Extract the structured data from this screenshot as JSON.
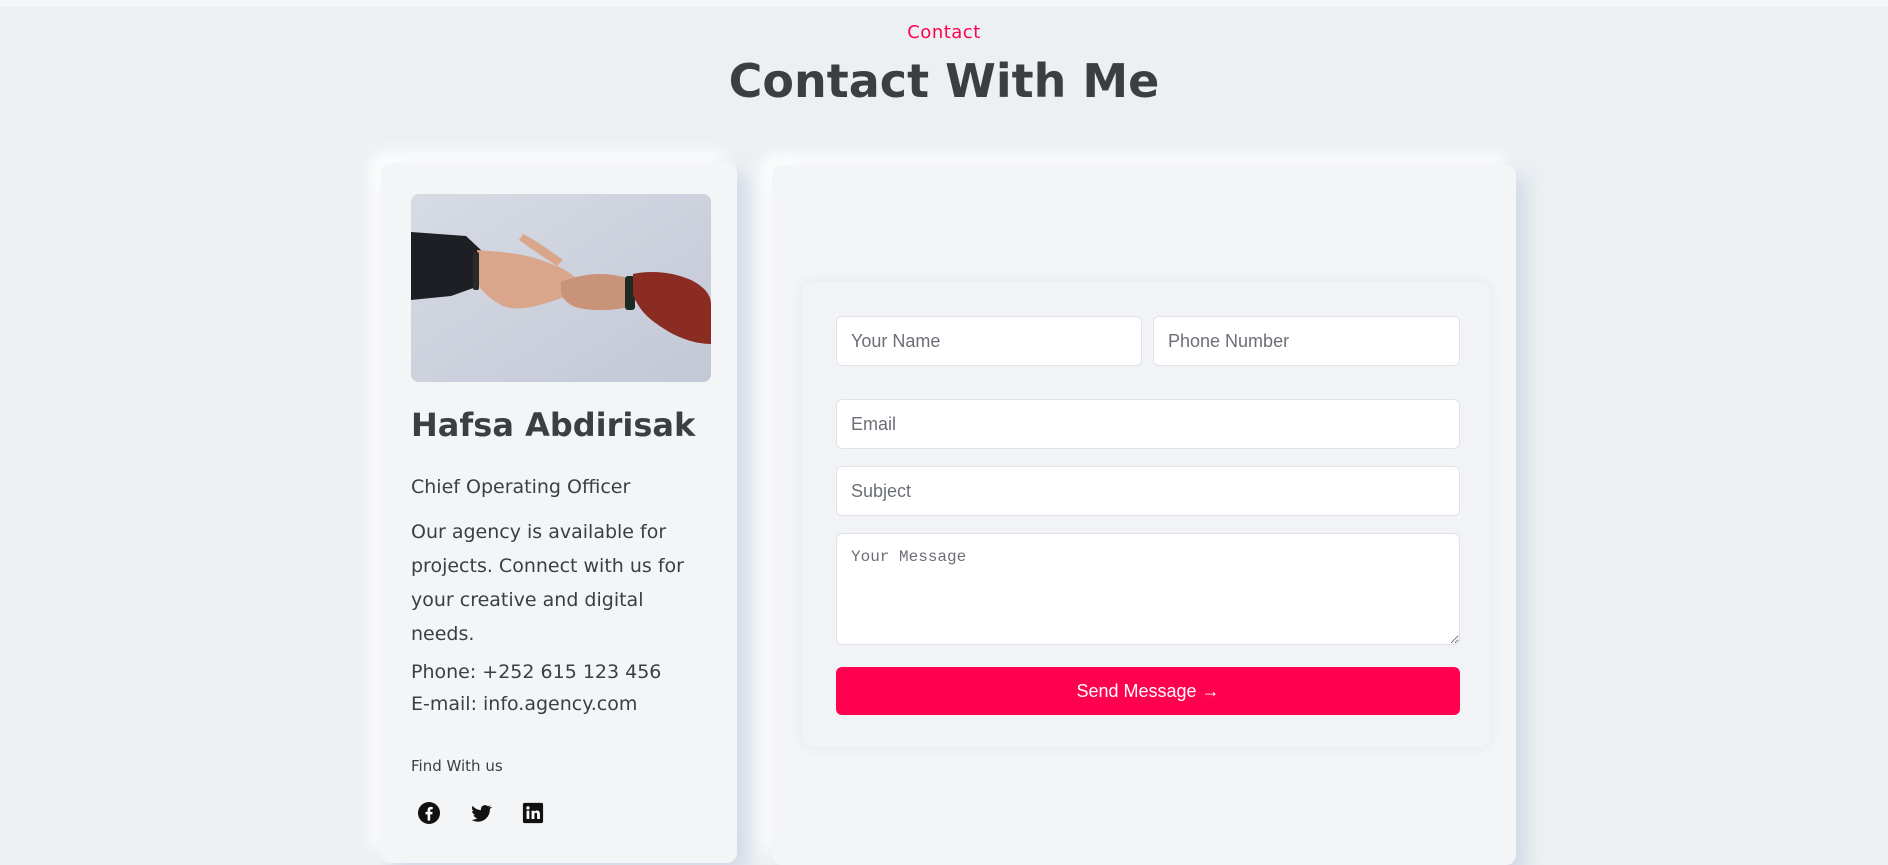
{
  "section": {
    "eyebrow": "Contact",
    "title": "Contact With Me"
  },
  "profile": {
    "photo_icon": "handshake-photo",
    "name": "Hafsa Abdirisak",
    "role": "Chief Operating Officer",
    "description": "Our agency is available for projects. Connect with us for your creative and digital needs.",
    "phone": "Phone: +252 615 123 456",
    "email": "E-mail: info.agency.com",
    "find_label": "Find With us",
    "social": [
      "facebook-icon",
      "twitter-icon",
      "linkedin-icon"
    ]
  },
  "form": {
    "name_placeholder": "Your Name",
    "phone_placeholder": "Phone Number",
    "email_placeholder": "Email",
    "subject_placeholder": "Subject",
    "message_placeholder": "Your Message",
    "submit_label": "Send Message →"
  },
  "colors": {
    "accent": "#ff014f",
    "background": "#ecf0f3",
    "text": "#3c3e41"
  }
}
